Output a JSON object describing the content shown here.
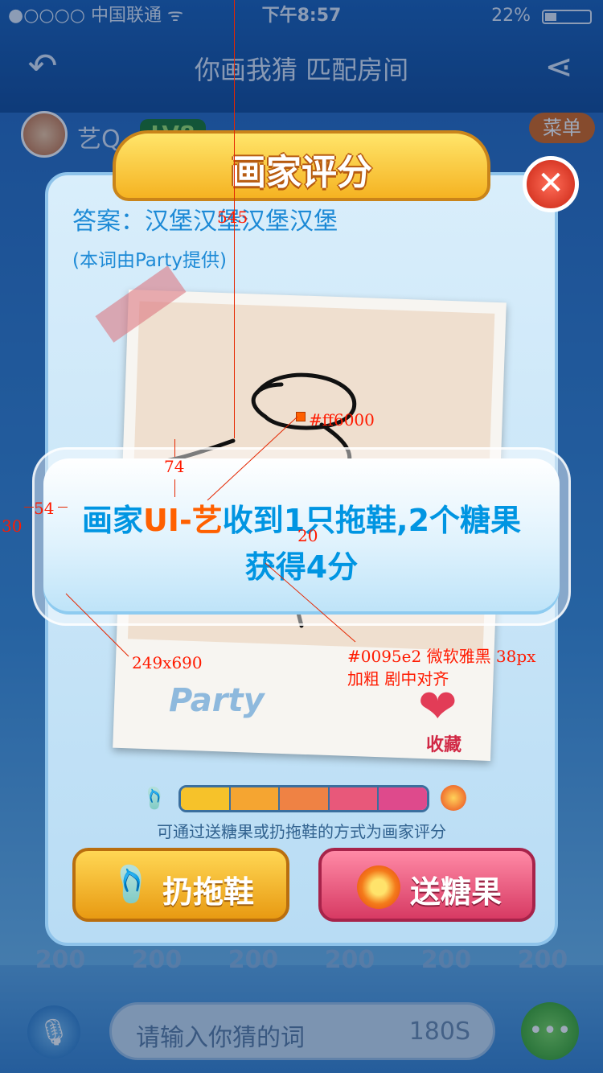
{
  "status_bar": {
    "carrier": "●○○○○ 中国联通 ᯤ",
    "time": "下午8:57",
    "battery": "22%"
  },
  "nav": {
    "title": "你画我猜  匹配房间",
    "back_icon": "back-icon",
    "share_icon": "share-icon"
  },
  "player": {
    "name": "艺Q",
    "level": "LV8",
    "menu": "菜单"
  },
  "dialog": {
    "title": "画家评分",
    "answer": "答案：汉堡汉堡汉堡汉堡",
    "provider": "(本词由Party提供)",
    "author": "Party",
    "favorite": "收藏",
    "hint": "可通过送糖果或扔拖鞋的方式为画家评分",
    "throw_button": "扔拖鞋",
    "candy_button": "送糖果",
    "close_icon": "close-icon"
  },
  "toast": {
    "pre": "画家",
    "name": "UI-艺",
    "post": "收到1只拖鞋,2个糖果",
    "line2": "获得4分"
  },
  "scores": [
    "200",
    "200",
    "200",
    "200",
    "200",
    "200"
  ],
  "input": {
    "placeholder": "请输入你猜的词",
    "timer": "180S"
  },
  "annotations": {
    "a545": "545",
    "a74": "74",
    "a54": "54",
    "a30": "30",
    "a20": "20",
    "color_orange": "#ff6000",
    "size": "249x690",
    "font_spec_1": "#0095e2 微软雅黑 38px",
    "font_spec_2": "加粗 剧中对齐"
  },
  "colors": {
    "text_blue": "#0095e2",
    "highlight": "#ff6000",
    "annotation": "#ff1a00"
  },
  "rating_bar_colors": [
    "#f6c22a",
    "#f5a531",
    "#ef8244",
    "#e8587a",
    "#de4a8c"
  ]
}
